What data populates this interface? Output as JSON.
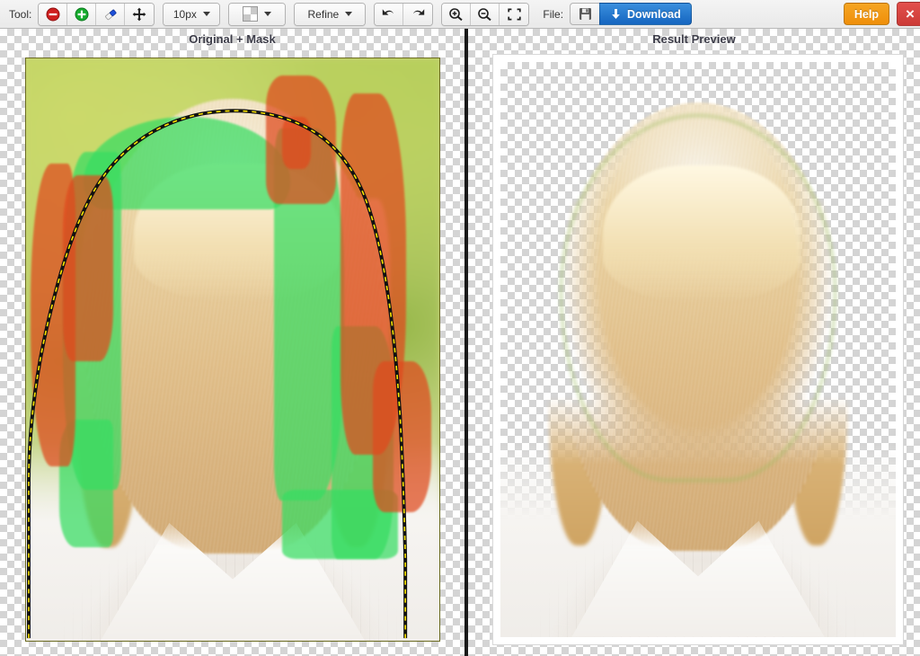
{
  "toolbar": {
    "tool_label": "Tool:",
    "file_label": "File:",
    "tools": [
      {
        "name": "background-brush-tool",
        "icon": "minus-circle-icon",
        "title": "Mark background",
        "active": false
      },
      {
        "name": "foreground-brush-tool",
        "icon": "plus-circle-icon",
        "title": "Mark foreground",
        "active": false
      },
      {
        "name": "eraser-tool",
        "icon": "eraser-icon",
        "title": "Eraser",
        "active": false
      },
      {
        "name": "move-tool",
        "icon": "move-cross-icon",
        "title": "Move",
        "active": false
      }
    ],
    "brush_size": {
      "value": "10px",
      "icon": "chevron-down-icon"
    },
    "background_swatch": {
      "value": "transparent-checker",
      "icon": "chevron-down-icon"
    },
    "refine": {
      "label": "Refine",
      "icon": "chevron-down-icon"
    },
    "history": [
      {
        "name": "undo-button",
        "icon": "undo-arrow-icon"
      },
      {
        "name": "redo-button",
        "icon": "redo-arrow-icon"
      }
    ],
    "zoom": [
      {
        "name": "zoom-in-button",
        "icon": "magnifier-plus-icon"
      },
      {
        "name": "zoom-out-button",
        "icon": "magnifier-minus-icon"
      },
      {
        "name": "fit-to-screen-button",
        "icon": "fit-frame-icon"
      }
    ],
    "save": {
      "label": "",
      "icon": "floppy-disk-icon"
    },
    "download": {
      "label": "Download",
      "icon": "download-arrow-icon"
    },
    "help": {
      "label": "Help"
    },
    "close": {
      "label": "×",
      "icon": "close-x-icon"
    }
  },
  "colors": {
    "foreground_mark": "#37dd62",
    "background_mark": "#e04a1e",
    "selection_outline_dark": "#111111",
    "selection_outline_light": "#ffe800",
    "download_accent": "#1565c0",
    "help_accent": "#f5a623",
    "close_accent": "#cc3b37",
    "toolbar_bg": "#ececec",
    "divider": "#1a1a1a"
  },
  "panes": {
    "left": {
      "title": "Original + Mask"
    },
    "right": {
      "title": "Result Preview"
    }
  }
}
